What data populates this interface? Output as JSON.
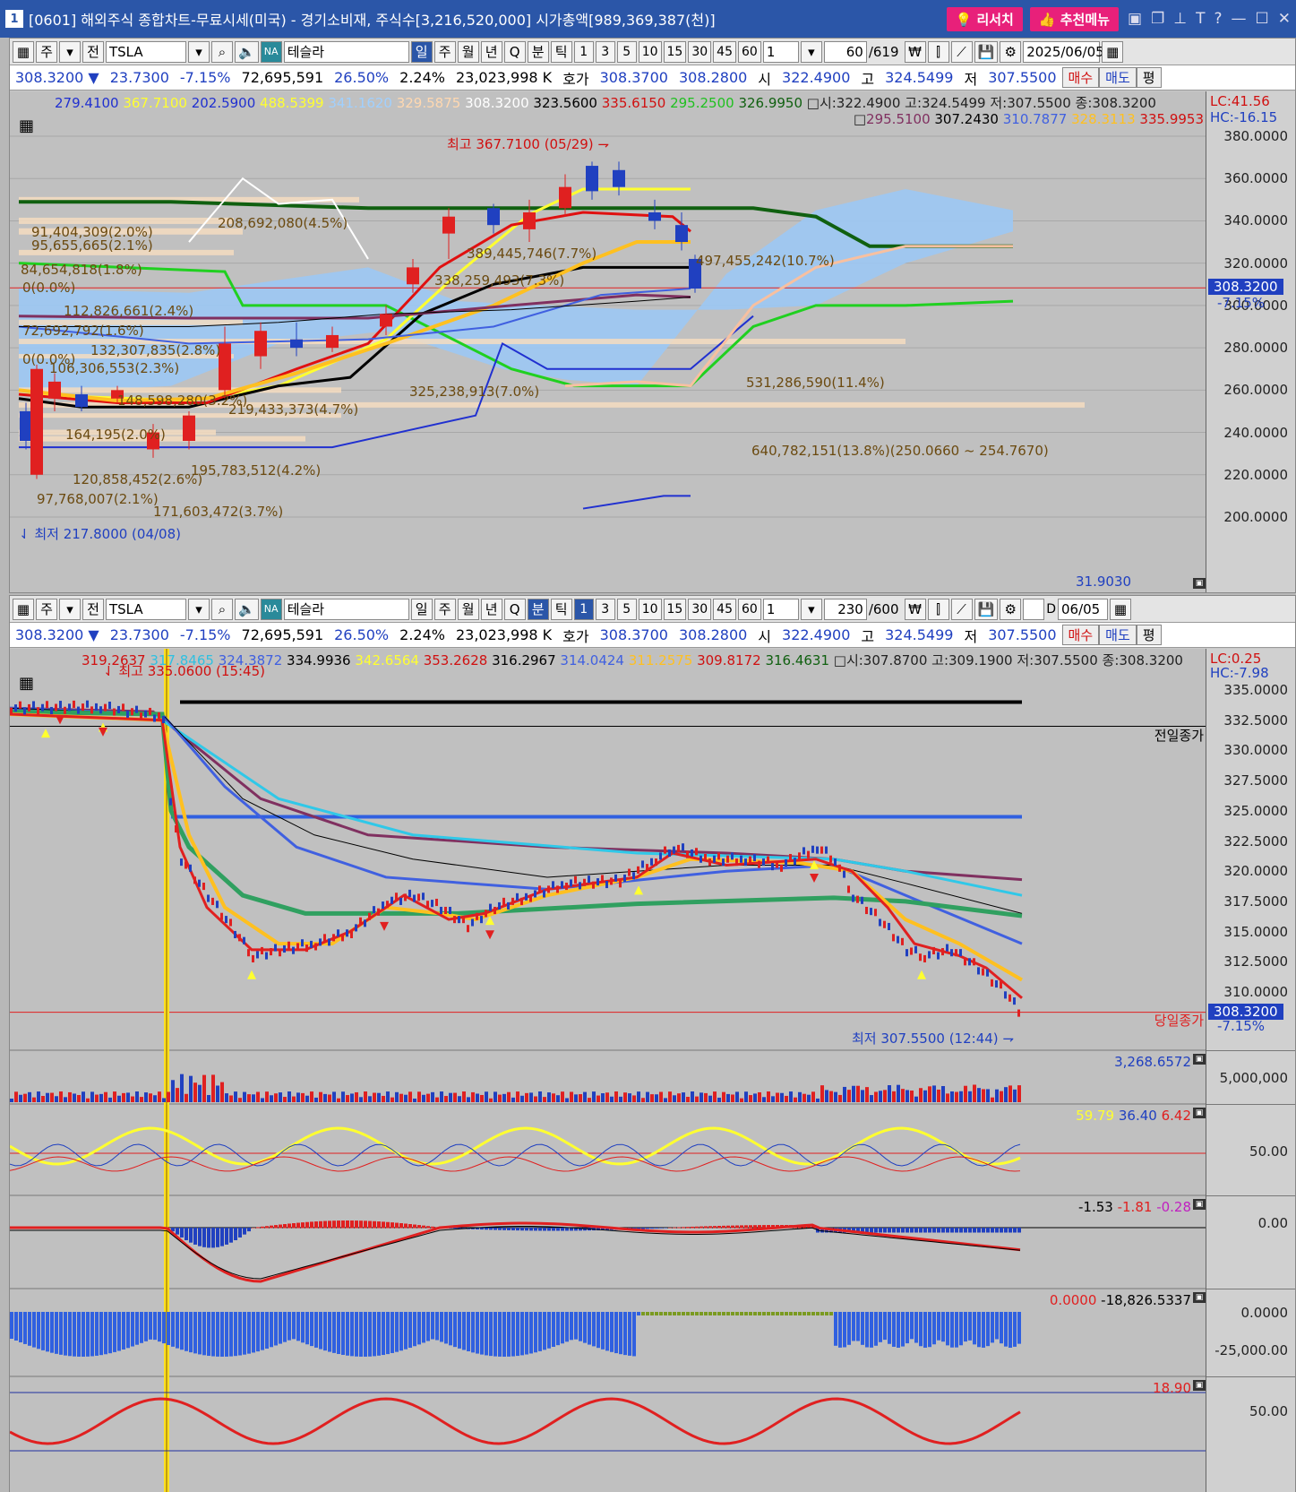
{
  "window": {
    "num": "1",
    "title": "[0601] 해외주식 종합차트-무료시세(미국) - 경기소비재, 주식수[3,216,520,000] 시가총액[989,369,387(천)]",
    "research": "리서치",
    "recommend": "추천메뉴"
  },
  "top": {
    "toolbar": {
      "type": "주",
      "all": "전",
      "ticker": "TSLA",
      "name": "테슬라",
      "periods": [
        "일",
        "주",
        "월",
        "년",
        "Q",
        "분",
        "틱"
      ],
      "active": "일",
      "mins": [
        "1",
        "3",
        "5",
        "10",
        "15",
        "30",
        "45",
        "60"
      ],
      "count": "1",
      "bars": "60",
      "total": "/619",
      "date": "2025/06/05"
    },
    "quote": {
      "price": "308.3200",
      "arrow": "▼",
      "change": "23.7300",
      "pct": "-7.15%",
      "volume": "72,695,591",
      "turnover": "26.50%",
      "ratio": "2.24%",
      "amount": "23,023,998 K",
      "bidlbl": "호가",
      "bid": "308.3700",
      "ask": "308.2800",
      "olbl": "시",
      "open": "322.4900",
      "hlbl": "고",
      "high": "324.5499",
      "llbl": "저",
      "low": "307.5500",
      "buy": "매수",
      "sell": "매도",
      "avg": "평"
    },
    "legend1": [
      {
        "t": "279.4100",
        "c": "#2030d0"
      },
      {
        "t": "367.7100",
        "c": "#ffff30"
      },
      {
        "t": "202.5900",
        "c": "#2030d0"
      },
      {
        "t": "488.5399",
        "c": "#ffff30"
      },
      {
        "t": "341.1620",
        "c": "#a0d0ff"
      },
      {
        "t": "329.5875",
        "c": "#ffd8b0"
      },
      {
        "t": "308.3200",
        "c": "#ffffff"
      },
      {
        "t": "323.5600",
        "c": "#000"
      },
      {
        "t": "335.6150",
        "c": "#d01010"
      },
      {
        "t": "295.2500",
        "c": "#20c020"
      },
      {
        "t": "326.9950",
        "c": "#106010"
      }
    ],
    "legend1b": "시:322.4900 고:324.5499 저:307.5500 종:308.3200",
    "legend2": [
      {
        "t": "295.5100",
        "c": "#803060"
      },
      {
        "t": "307.2430",
        "c": "#000"
      },
      {
        "t": "310.7877",
        "c": "#4060e0"
      },
      {
        "t": "328.3113",
        "c": "#ffc020"
      },
      {
        "t": "335.9953",
        "c": "#d01010"
      }
    ],
    "lc": "LC:41.56",
    "hc": "HC:-16.15",
    "axis": [
      "380.0000",
      "360.0000",
      "340.0000",
      "320.0000",
      "300.0000",
      "280.0000",
      "260.0000",
      "240.0000",
      "220.0000",
      "200.0000"
    ],
    "curprice": "308.3200",
    "curpct": "-7.15%",
    "bottomval": "31.9030",
    "high": "최고 367.7100 (05/29)",
    "low": "최저 217.8000 (04/08)",
    "vp": [
      "91,404,309(2.0%)",
      "95,655,665(2.1%)",
      "208,692,080(4.5%)",
      "84,654,818(1.8%)",
      "0(0.0%)",
      "112,826,661(2.4%)",
      "72,692,792(1.6%)",
      "132,307,835(2.8%)",
      "0(0.0%)",
      "106,306,553(2.3%)",
      "148,598,280(3.2%)",
      "219,433,373(4.7%)",
      "164,195(2.0%)",
      "120,858,452(2.6%)",
      "195,783,512(4.2%)",
      "97,768,007(2.1%)",
      "171,603,472(3.7%)",
      "389,445,746(7.7%)",
      "497,455,242(10.7%)",
      "338,259,493(7.3%)",
      "325,238,913(7.0%)",
      "531,286,590(11.4%)",
      "640,782,151(13.8%)(250.0660 ~ 254.7670)"
    ]
  },
  "bottom": {
    "toolbar": {
      "bars": "230",
      "total": "/600",
      "date": "06/05",
      "dlabel": "D",
      "active": "분",
      "activeMin": "1"
    },
    "legend1": [
      {
        "t": "319.2637",
        "c": "#d01010"
      },
      {
        "t": "317.8465",
        "c": "#30c0e0"
      },
      {
        "t": "324.3872",
        "c": "#4060e0"
      },
      {
        "t": "334.9936",
        "c": "#000"
      },
      {
        "t": "342.6564",
        "c": "#ffff30"
      },
      {
        "t": "353.2628",
        "c": "#d01010"
      },
      {
        "t": "316.2967",
        "c": "#000"
      },
      {
        "t": "314.0424",
        "c": "#4060e0"
      },
      {
        "t": "311.2575",
        "c": "#ffc020"
      },
      {
        "t": "309.8172",
        "c": "#d01010"
      },
      {
        "t": "316.4631",
        "c": "#106010"
      }
    ],
    "legend1b": "시:307.8700 고:309.1900 저:307.5500 종:308.3200",
    "lc": "LC:0.25",
    "hc": "HC:-7.98",
    "axis": [
      "335.0000",
      "332.5000",
      "330.0000",
      "327.5000",
      "325.0000",
      "322.5000",
      "320.0000",
      "317.5000",
      "315.0000",
      "312.5000",
      "310.0000"
    ],
    "prevclose": "전일종가",
    "todayclose": "당일종가",
    "curprice": "308.3200",
    "curpct": "-7.15%",
    "high": "최고 335.0600 (15:45)",
    "low": "최저 307.5500 (12:44)",
    "volval": "3,268.6572",
    "volaxis": "5,000,000",
    "stoch": [
      "59.79",
      "36.40",
      "6.42"
    ],
    "stochaxis": "50.00",
    "macd": [
      "-1.53",
      "-1.81",
      "-0.28"
    ],
    "macdaxis": "0.00",
    "obv": [
      "0.0000",
      "-18,826.5337"
    ],
    "obvaxis": [
      "0.0000",
      "-25,000.00"
    ],
    "rsi": "18.90",
    "rsiaxis": "50.00"
  }
}
